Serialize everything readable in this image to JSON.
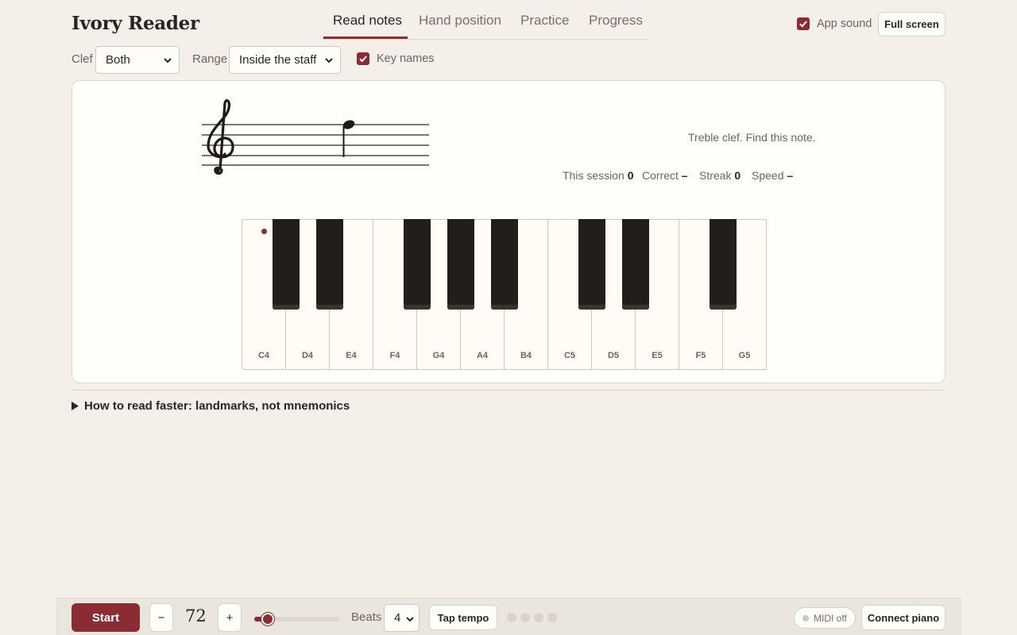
{
  "app": {
    "title": "Ivory Reader"
  },
  "tabs": [
    {
      "label": "Read notes",
      "active": true
    },
    {
      "label": "Hand position",
      "active": false
    },
    {
      "label": "Practice",
      "active": false
    },
    {
      "label": "Progress",
      "active": false
    }
  ],
  "header": {
    "app_sound_label": "App sound",
    "app_sound_checked": true,
    "fullscreen_label": "Full screen"
  },
  "controls": {
    "clef_label": "Clef",
    "clef_value": "Both",
    "range_label": "Range",
    "range_value": "Inside the staff",
    "key_names_label": "Key names",
    "key_names_checked": true
  },
  "exercise": {
    "clef_icon": "treble-clef-icon",
    "note_icon": "quarter-note-icon",
    "prompt": "Treble clef. Find this note.",
    "stats": [
      {
        "label": "This session",
        "value": "0"
      },
      {
        "label": "Correct",
        "value": "–"
      },
      {
        "label": "Streak",
        "value": "0"
      },
      {
        "label": "Speed",
        "value": "–"
      }
    ]
  },
  "keyboard": {
    "white_keys": [
      "C4",
      "D4",
      "E4",
      "F4",
      "G4",
      "A4",
      "B4",
      "C5",
      "D5",
      "E5",
      "F5",
      "G5"
    ],
    "black_keys_after": [
      "C4",
      "D4",
      "F4",
      "G4",
      "A4",
      "C5",
      "D5",
      "F5"
    ],
    "marked_key": "C4"
  },
  "details": {
    "summary": "How to read faster: landmarks, not mnemonics"
  },
  "transport": {
    "start_label": "Start",
    "decrement_label": "−",
    "tempo": "72",
    "increment_label": "+",
    "tempo_slider": {
      "min": 40,
      "max": 240,
      "value": 72
    },
    "beats_label": "Beats",
    "beats_value": "4",
    "tap_tempo_label": "Tap tempo",
    "beat_count": 4,
    "midi_status": "MIDI off",
    "connect_label": "Connect piano"
  },
  "colors": {
    "accent": "#8b2b34",
    "background": "#f4f0e9",
    "card": "#fffefb"
  }
}
